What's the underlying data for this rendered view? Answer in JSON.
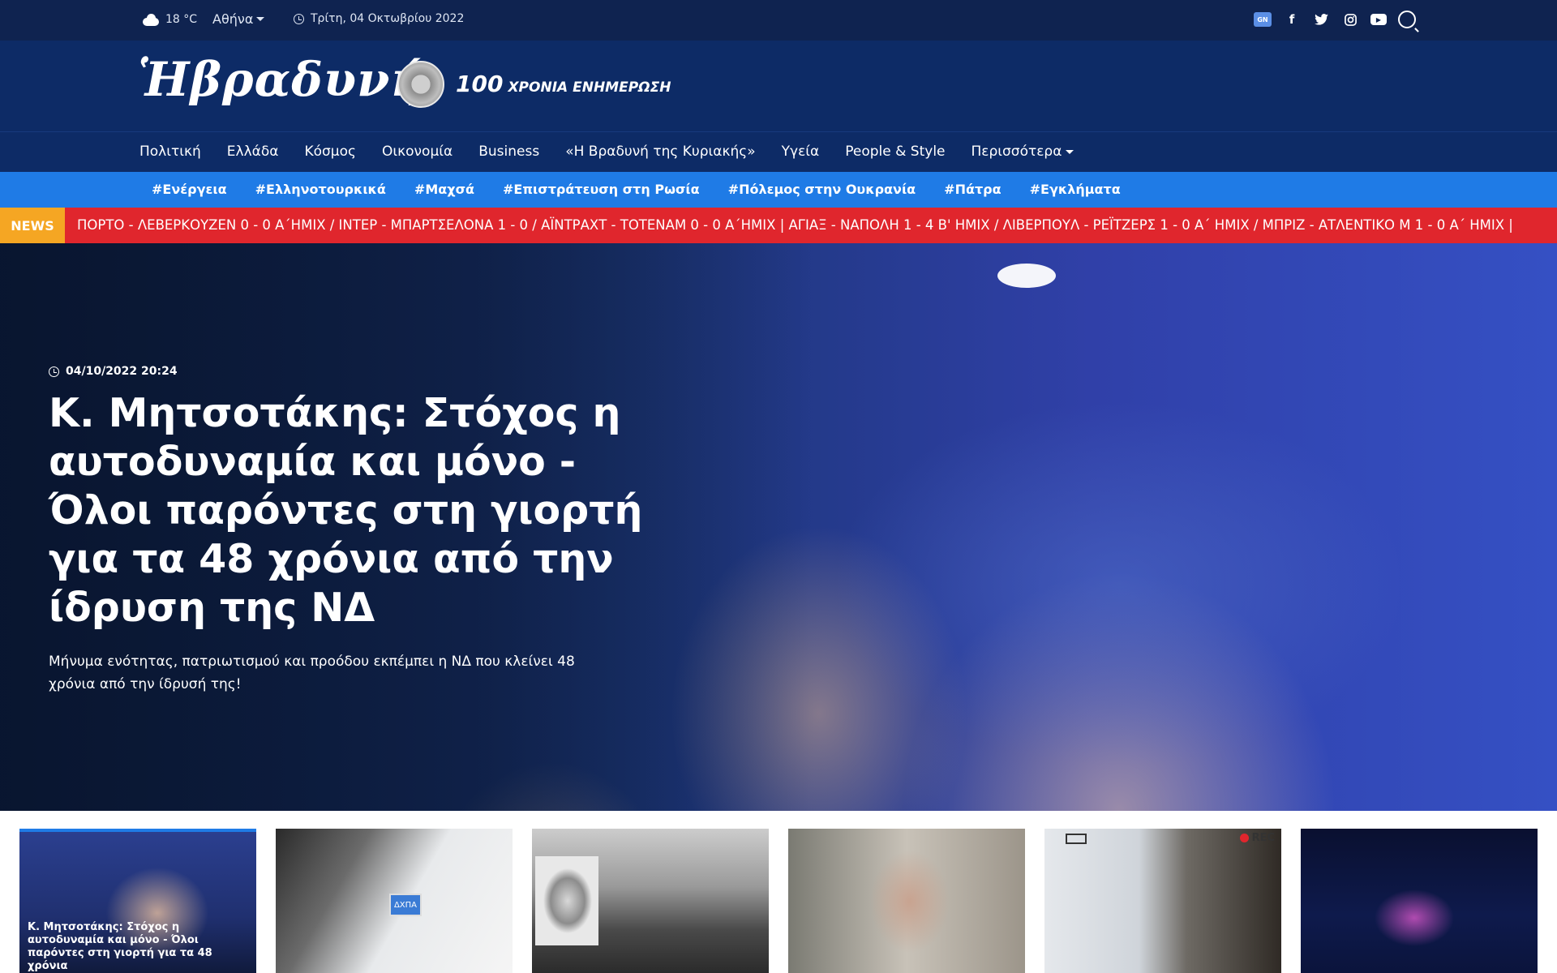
{
  "topbar": {
    "temperature": "18 °C",
    "city": "Αθήνα",
    "date": "Τρίτη, 04 Οκτωβρίου 2022",
    "gnews_label": "GN",
    "social_icons": [
      "google-news-icon",
      "facebook-icon",
      "twitter-icon",
      "instagram-icon",
      "youtube-icon",
      "search-icon"
    ]
  },
  "header": {
    "logo": "Ἡβραδυνή",
    "tagline_number": "100",
    "tagline_text": "ΧΡΟΝΙΑ ΕΝΗΜΕΡΩΣΗ"
  },
  "main_nav": [
    {
      "label": "Πολιτική"
    },
    {
      "label": "Ελλάδα"
    },
    {
      "label": "Κόσμος"
    },
    {
      "label": "Οικονομία"
    },
    {
      "label": "Business"
    },
    {
      "label": "«Η Βραδυνή της Κυριακής»"
    },
    {
      "label": "Υγεία"
    },
    {
      "label": "People & Style"
    },
    {
      "label": "Περισσότερα"
    }
  ],
  "tag_nav": [
    {
      "label": "#Ενέργεια"
    },
    {
      "label": "#Ελληνοτουρκικά"
    },
    {
      "label": "#Μαχσά"
    },
    {
      "label": "#Επιστράτευση στη Ρωσία"
    },
    {
      "label": "#Πόλεμος στην Ουκρανία"
    },
    {
      "label": "#Πάτρα"
    },
    {
      "label": "#Εγκλήματα"
    }
  ],
  "ticker": {
    "badge": "NEWS",
    "text": "ΠΟΡΤΟ - ΛΕΒΕΡΚΟΥΖΕΝ 0 - 0 Α΄ΗΜΙΧ / ΙΝΤΕΡ - ΜΠΑΡΤΣΕΛΟΝΑ 1 - 0 / ΑΪΝΤΡΑΧΤ - ΤΟΤΕΝΑΜ 0 - 0 Α΄ΗΜΙΧ   |   ΑΓΙΑΞ - ΝΑΠΟΛΗ 1 - 4 Β' ΗΜΙΧ / ΛΙΒΕΡΠΟΥΛ - ΡΕΪΤΖΕΡΣ 1 - 0 Α΄ ΗΜΙΧ / ΜΠΡΙΖ - ΑΤΛΕΝΤΙΚΟ Μ 1 - 0 Α΄ ΗΜΙΧ   |"
  },
  "hero": {
    "date": "04/10/2022 20:24",
    "title": "Κ. Μητσοτάκης: Στόχος η αυτοδυναμία και μόνο - Όλοι παρόντες στη γιορτή για τα 48 χρόνια από την ίδρυση της ΝΔ",
    "summary": "Μήνυμα ενότητας, πατριωτισμού και προόδου εκπέμπει η ΝΔ που κλείνει 48 χρόνια από την ίδρυσή της!"
  },
  "cards": [
    {
      "label": "Κ. Μητσοτάκης: Στόχος η αυτοδυναμία και μόνο - Όλοι παρόντες στη γιορτή για τα 48 χρόνια"
    },
    {
      "label": ""
    },
    {
      "label": ""
    },
    {
      "label": ""
    },
    {
      "label": ""
    },
    {
      "label": ""
    }
  ],
  "card2_sign": "ΔΧΠΑ",
  "card5_rec": "REC",
  "colors": {
    "topbar": "#0f2350",
    "header": "#0d2b66",
    "tag_nav": "#1f7be6",
    "ticker": "#e0262d",
    "ticker_badge": "#f5a623"
  }
}
